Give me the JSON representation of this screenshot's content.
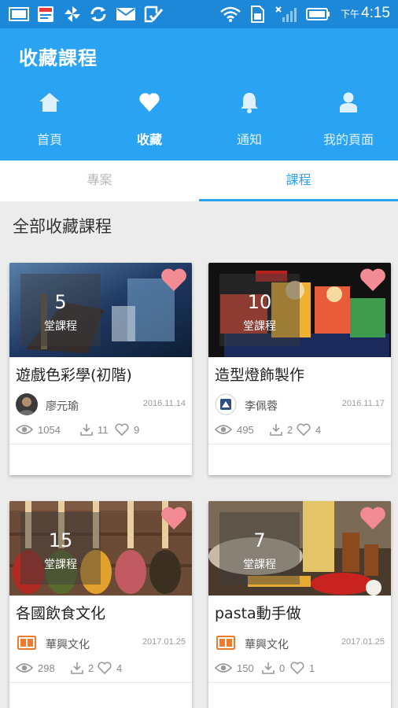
{
  "status_bar": {
    "time_prefix": "下午",
    "time": "4:15"
  },
  "app": {
    "title": "收藏課程"
  },
  "nav": [
    {
      "label": "首頁",
      "icon": "home-icon"
    },
    {
      "label": "收藏",
      "icon": "heart-icon"
    },
    {
      "label": "通知",
      "icon": "bell-icon"
    },
    {
      "label": "我的頁面",
      "icon": "person-icon"
    }
  ],
  "tabs": [
    {
      "label": "專案"
    },
    {
      "label": "課程"
    }
  ],
  "section_title": "全部收藏課程",
  "courses": [
    {
      "lessons": "5",
      "lessons_unit": "堂課程",
      "title": "遊戲色彩學(初階)",
      "author": "廖元瑜",
      "date": "2016.11.14",
      "views": "1054",
      "downloads": "11",
      "likes": "9"
    },
    {
      "lessons": "10",
      "lessons_unit": "堂課程",
      "title": "造型燈飾製作",
      "author": "李佩蓉",
      "date": "2016.11.17",
      "views": "495",
      "downloads": "2",
      "likes": "4"
    },
    {
      "lessons": "15",
      "lessons_unit": "堂課程",
      "title": "各國飲食文化",
      "author": "華興文化",
      "date": "2017.01.25",
      "views": "298",
      "downloads": "2",
      "likes": "4"
    },
    {
      "lessons": "7",
      "lessons_unit": "堂課程",
      "title": "pasta動手做",
      "author": "華興文化",
      "date": "2017.01.25",
      "views": "150",
      "downloads": "0",
      "likes": "1"
    }
  ],
  "colors": {
    "primary": "#29a3f2",
    "status_bar": "#1e88d8",
    "heart": "#f28b93"
  }
}
